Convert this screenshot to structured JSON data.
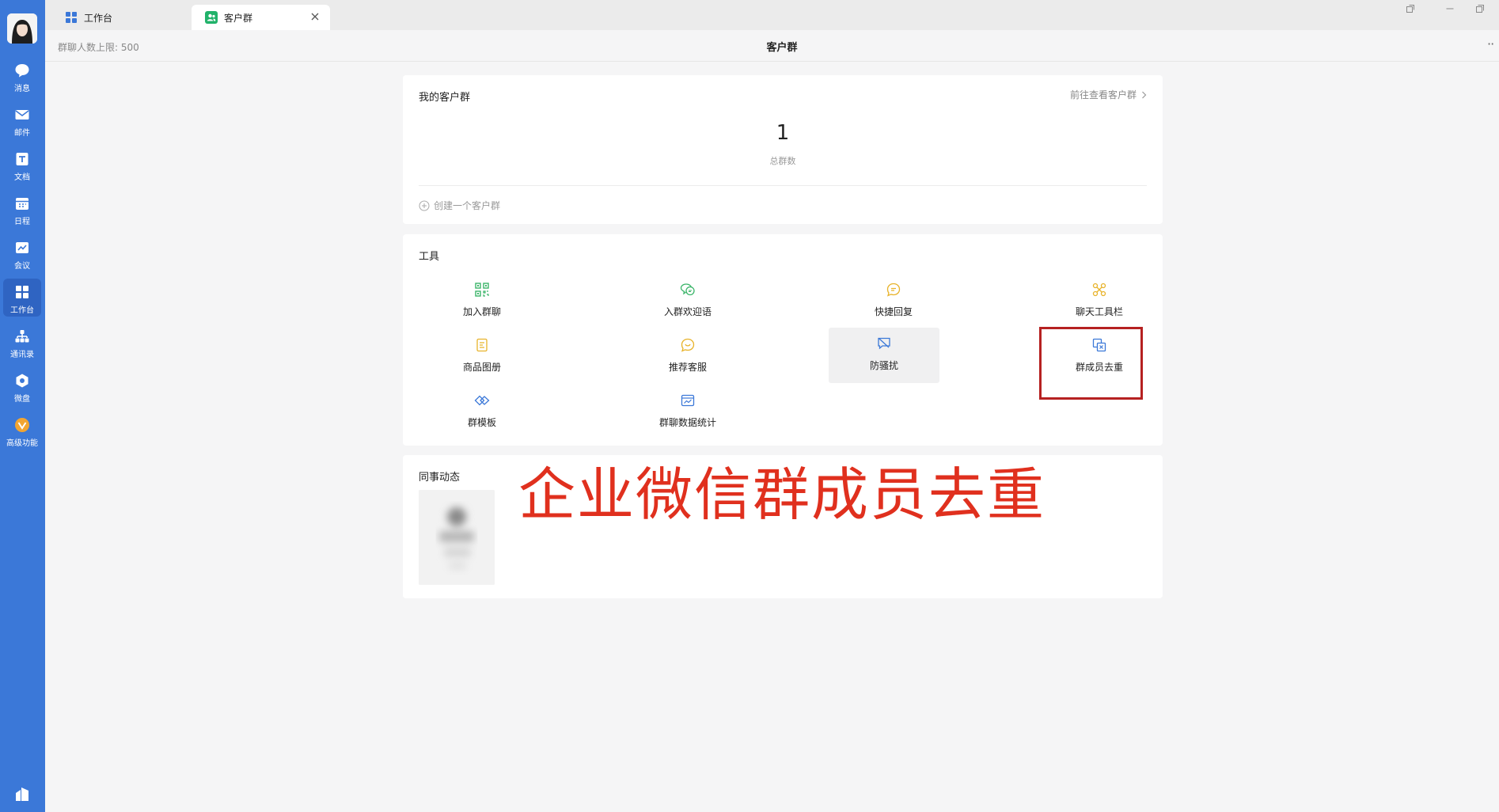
{
  "sidebar": {
    "items": [
      {
        "label": "消息",
        "icon": "chat-bubble-icon"
      },
      {
        "label": "邮件",
        "icon": "mail-icon"
      },
      {
        "label": "文档",
        "icon": "document-icon"
      },
      {
        "label": "日程",
        "icon": "calendar-icon"
      },
      {
        "label": "会议",
        "icon": "meeting-icon"
      },
      {
        "label": "工作台",
        "icon": "workbench-icon",
        "active": true
      },
      {
        "label": "通讯录",
        "icon": "contacts-icon"
      },
      {
        "label": "微盘",
        "icon": "drive-icon"
      },
      {
        "label": "高级功能",
        "icon": "premium-icon"
      }
    ]
  },
  "tabs": [
    {
      "label": "工作台",
      "icon": "workbench-tab-icon"
    },
    {
      "label": "客户群",
      "icon": "customer-group-tab-icon",
      "active": true
    }
  ],
  "header": {
    "limit_text": "群聊人数上限: 500",
    "title": "客户群",
    "more": "··"
  },
  "groups_card": {
    "title": "我的客户群",
    "link": "前往查看客户群",
    "count": "1",
    "count_caption": "总群数",
    "create_label": "创建一个客户群"
  },
  "tools_card": {
    "title": "工具",
    "items": [
      {
        "label": "加入群聊",
        "icon": "qr-code-icon",
        "color": "#3cb56a"
      },
      {
        "label": "入群欢迎语",
        "icon": "welcome-chat-icon",
        "color": "#3cb56a"
      },
      {
        "label": "快捷回复",
        "icon": "quick-reply-icon",
        "color": "#e8b32b"
      },
      {
        "label": "聊天工具栏",
        "icon": "chat-toolbar-icon",
        "color": "#e8b32b"
      },
      {
        "label": "商品图册",
        "icon": "product-album-icon",
        "color": "#e8b32b"
      },
      {
        "label": "推荐客服",
        "icon": "recommend-service-icon",
        "color": "#e8b32b"
      },
      {
        "label": "防骚扰",
        "icon": "anti-harass-icon",
        "color": "#3b78d8"
      },
      {
        "label": "群成员去重",
        "icon": "dedupe-members-icon",
        "color": "#3b78d8"
      },
      {
        "label": "群模板",
        "icon": "group-template-icon",
        "color": "#3b78d8"
      },
      {
        "label": "群聊数据统计",
        "icon": "group-stats-icon",
        "color": "#3b78d8"
      }
    ]
  },
  "feed_card": {
    "title": "同事动态"
  },
  "overlay": {
    "text": "企业微信群成员去重",
    "color": "#e0301e"
  }
}
